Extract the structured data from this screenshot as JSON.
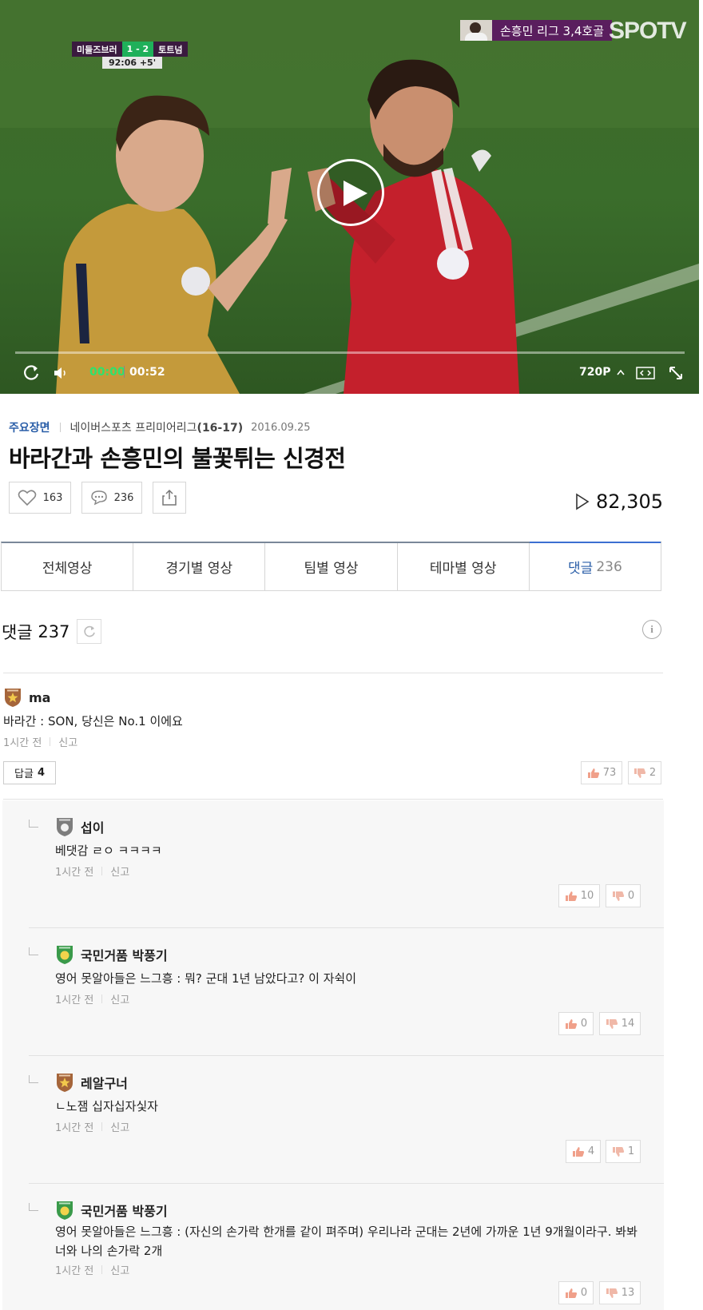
{
  "player": {
    "scoreboard": {
      "home": "미들즈브러",
      "score": "1 - 2",
      "away": "토트넘",
      "clock": "92:06 +5'"
    },
    "headline_badge": "손흥민 리그 3,4호골",
    "channel_logo": "SPOTV",
    "current_time": "00:00",
    "duration": "00:52",
    "quality": "720P",
    "progress": 0
  },
  "meta": {
    "category": "주요장면",
    "league": "네이버스포츠 프리미어리그",
    "season": "(16-17)",
    "date": "2016.09.25"
  },
  "title": "바라간과 손흥민의 불꽃튀는 신경전",
  "actions": {
    "likes": "163",
    "comments": "236",
    "views": "82,305"
  },
  "tabs": [
    {
      "label": "전체영상"
    },
    {
      "label": "경기별 영상"
    },
    {
      "label": "팀별 영상"
    },
    {
      "label": "테마별 영상"
    },
    {
      "label": "댓글",
      "count": "236",
      "active": true
    }
  ],
  "comments": {
    "header_label": "댓글",
    "count": "237",
    "top": {
      "author": "ma",
      "badge": "bronze",
      "text": "바라간 : SON, 당신은 No.1 이에요",
      "time": "1시간 전",
      "report": "신고",
      "reply_label": "답글",
      "reply_count": "4",
      "up": "73",
      "down": "2"
    },
    "replies": [
      {
        "author": "섭이",
        "badge": "silver",
        "text": "베댓감 ㄹㅇ ㅋㅋㅋㅋ",
        "time": "1시간 전",
        "report": "신고",
        "up": "10",
        "down": "0"
      },
      {
        "author": "국민거품 박풍기",
        "badge": "green",
        "text": "영어 못알아들은 느그흥 : 뭐? 군대 1년 남았다고? 이 자쉭이",
        "time": "1시간 전",
        "report": "신고",
        "up": "0",
        "down": "14"
      },
      {
        "author": "레알구너",
        "badge": "bronze",
        "text": "ㄴ노잼 십자십자싳자",
        "time": "1시간 전",
        "report": "신고",
        "up": "4",
        "down": "1"
      },
      {
        "author": "국민거품 박풍기",
        "badge": "green",
        "text": "영어 못알아들은 느그흥 : (자신의 손가락 한개를 같이 펴주며) 우리나라 군대는 2년에 가까운 1년 9개월이라구. 봐봐 너와 나의 손가락 2개",
        "time": "1시간 전",
        "report": "신고",
        "up": "0",
        "down": "13"
      }
    ]
  },
  "colors": {
    "accent": "#2a5ea8",
    "time_green": "#2ee26c",
    "score_green": "#1fb05a"
  }
}
